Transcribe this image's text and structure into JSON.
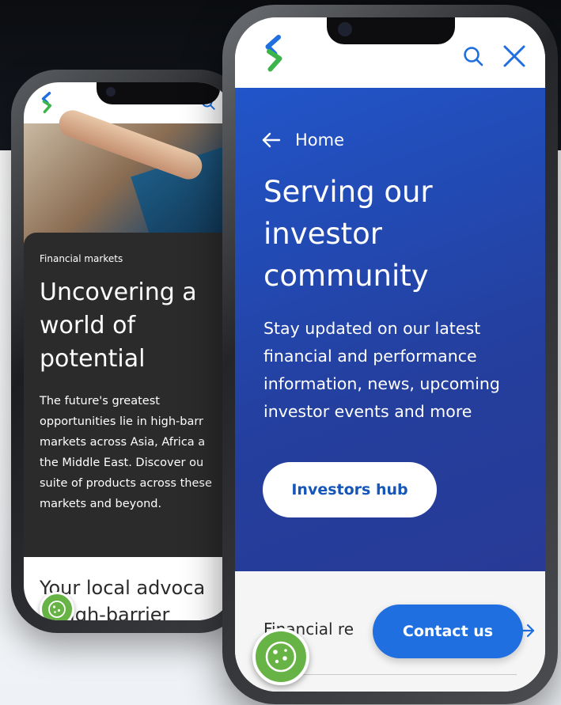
{
  "colors": {
    "brand_blue": "#1f6fe0",
    "hero_blue": "#243f9e",
    "brand_green": "#3bb54a",
    "cookie_green": "#67b346",
    "dark_card": "#2b2b2b"
  },
  "back_phone": {
    "logo_icon": "standard-chartered-logo-icon",
    "search_icon": "search-icon",
    "hero_image": "hand-touching-trading-tablet",
    "eyebrow": "Financial markets",
    "title": "Uncovering a\nworld of\npotential",
    "body": "The future's greatest\nopportunities lie in high-barr\nmarkets across Asia, Africa a\nthe Middle East. Discover ou\nsuite of products across these\nmarkets and beyond.",
    "subheading": "Your local advoca\nn high-barrier",
    "cookie_icon": "cookie-icon"
  },
  "front_phone": {
    "logo_icon": "standard-chartered-logo-icon",
    "search_icon": "search-icon",
    "close_icon": "close-icon",
    "back_label": "Home",
    "title": "Serving our\ninvestor\ncommunity",
    "body": "Stay updated on our latest\nfinancial and performance\ninformation, news, upcoming\ninvestor events and more",
    "cta_label": "Investors hub",
    "link_text": "Financial re",
    "contact_label": "Contact us",
    "cookie_icon": "cookie-icon"
  }
}
